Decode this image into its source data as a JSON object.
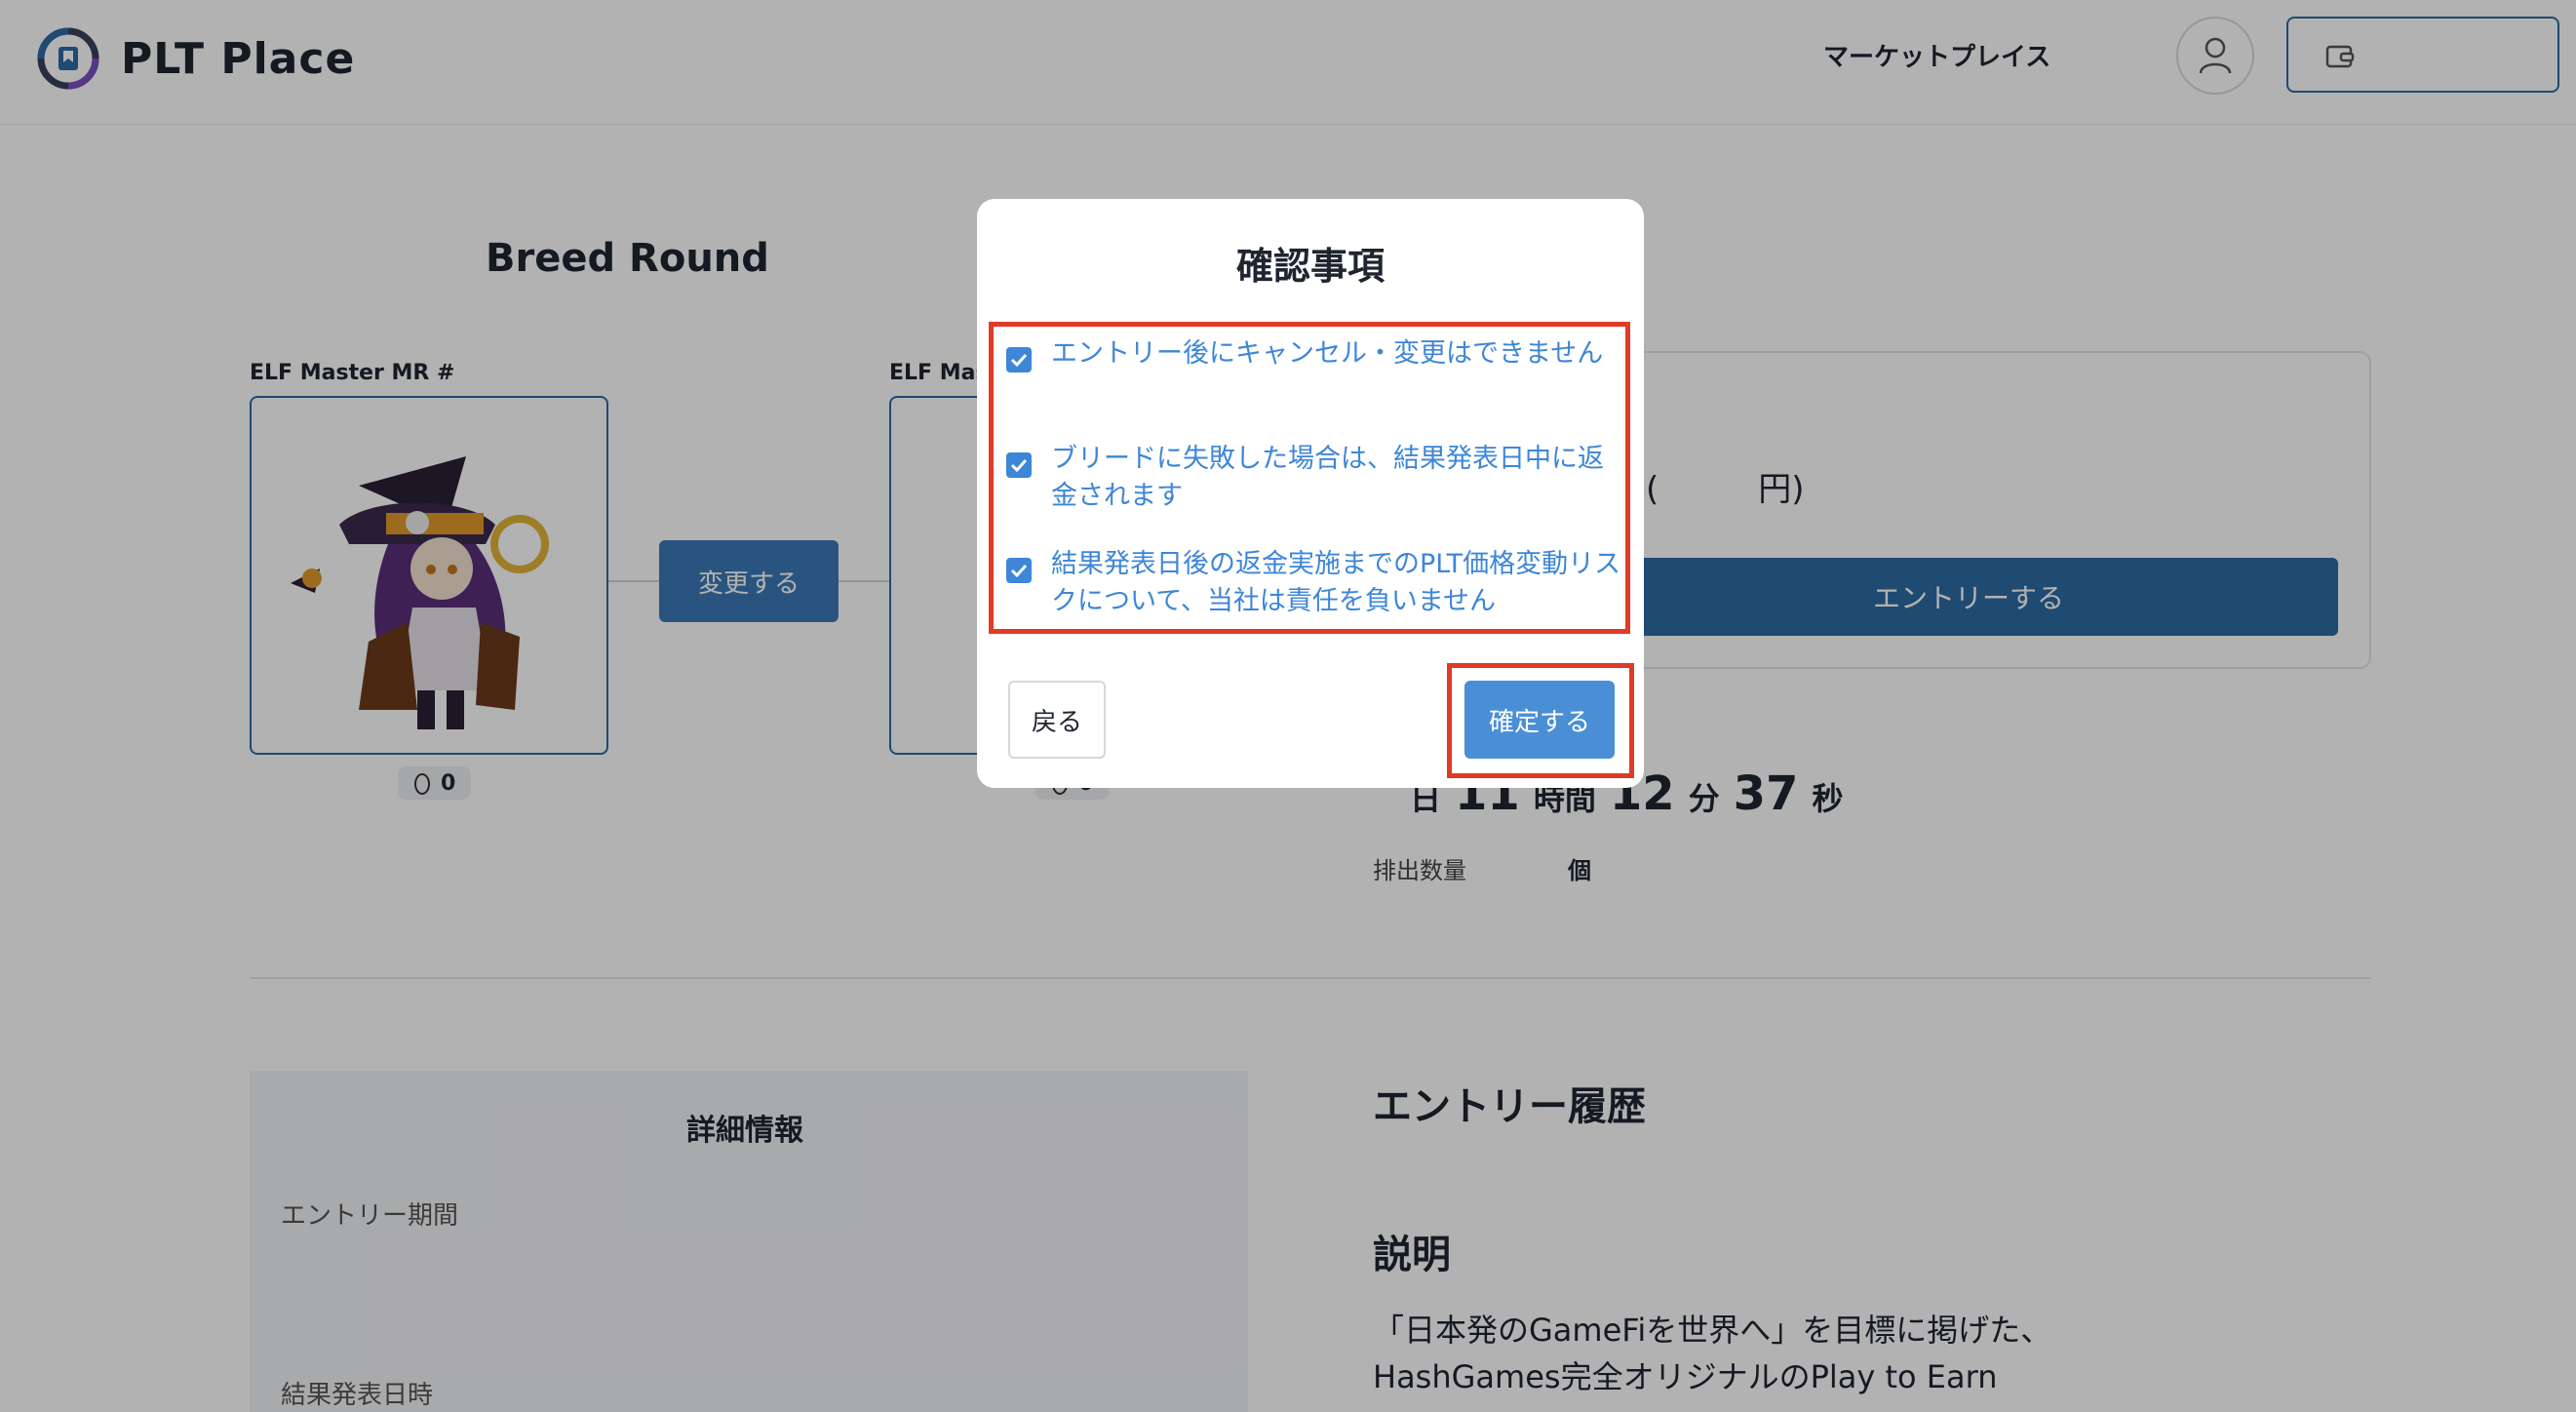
{
  "header": {
    "brand": "PLT Place",
    "nav_marketplace": "マーケットプレイス"
  },
  "breed": {
    "title": "Breed Round",
    "left_card": {
      "label": "ELF Master MR #",
      "egg_count": "0"
    },
    "right_card": {
      "label": "ELF Mast",
      "egg_count": "0"
    },
    "change_button": "変更する"
  },
  "entry_panel": {
    "price_text": "(　　　円)",
    "entry_button": "エントリーする"
  },
  "countdown": {
    "day_unit": "日",
    "hours": "11",
    "hours_unit": "時間",
    "minutes": "12",
    "minutes_unit": "分",
    "seconds": "37",
    "seconds_unit": "秒"
  },
  "output": {
    "label": "排出数量",
    "unit": "個"
  },
  "details": {
    "title": "詳細情報",
    "entry_period_label": "エントリー期間",
    "result_date_label": "結果発表日時"
  },
  "history_title": "エントリー履歴",
  "description": {
    "title": "説明",
    "text": "「日本発のGameFiを世界へ」を目標に掲げた、HashGames完全オリジナルのPlay to Earn"
  },
  "modal": {
    "title": "確認事項",
    "items": [
      {
        "text": "エントリー後にキャンセル・変更はできません",
        "checked": true
      },
      {
        "text": "ブリードに失敗した場合は、結果発表日中に返金されます",
        "checked": true
      },
      {
        "text": "結果発表日後の返金実施までのPLT価格変動リスクについて、当社は責任を負いません",
        "checked": true
      }
    ],
    "back_button": "戻る",
    "confirm_button": "確定する"
  },
  "colors": {
    "accent": "#3d86d8",
    "primary_button": "#2d6aa3",
    "highlight": "#e13a25"
  }
}
